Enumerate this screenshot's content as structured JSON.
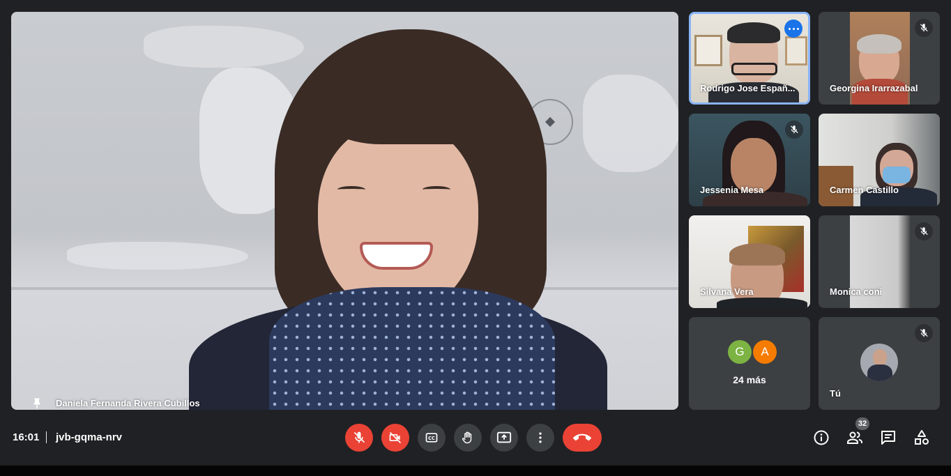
{
  "main": {
    "speaker_name": "Daniela Fernanda Rivera Cubillos",
    "pin_icon": "pin-icon"
  },
  "tiles": [
    {
      "name": "Rodrigo Jose Españ...",
      "state": "active-speaker",
      "control": "more-options-icon"
    },
    {
      "name": "Georgina Irarrazabal",
      "muted": true
    },
    {
      "name": "Jessenia Mesa",
      "muted": true
    },
    {
      "name": "Carmen Castillo",
      "muted": false
    },
    {
      "name": "Silvana Vera",
      "muted": false
    },
    {
      "name": "Monica coni",
      "muted": true
    }
  ],
  "overflow_tile": {
    "avatars": [
      {
        "letter": "G",
        "color": "#7cb342"
      },
      {
        "letter": "A",
        "color": "#f57c00"
      }
    ],
    "label": "24 más"
  },
  "self_tile": {
    "name": "Tú",
    "muted": true
  },
  "bottom_bar": {
    "time": "16:01",
    "meeting_code": "jvb-gqma-nrv",
    "controls": [
      {
        "name": "mic-off",
        "state": "off"
      },
      {
        "name": "camera-off",
        "state": "off"
      },
      {
        "name": "captions",
        "state": "default"
      },
      {
        "name": "raise-hand",
        "state": "default"
      },
      {
        "name": "present-screen",
        "state": "default"
      },
      {
        "name": "more-options",
        "state": "default"
      },
      {
        "name": "leave-call",
        "state": "danger"
      }
    ],
    "participants_count": "32",
    "right_icons": [
      "info-icon",
      "people-icon",
      "chat-icon",
      "activities-icon"
    ]
  },
  "colors": {
    "background": "#202124",
    "tile": "#3c4043",
    "danger": "#ea4335",
    "active_border": "#8ab4f8",
    "accent_blue": "#1a73e8"
  }
}
